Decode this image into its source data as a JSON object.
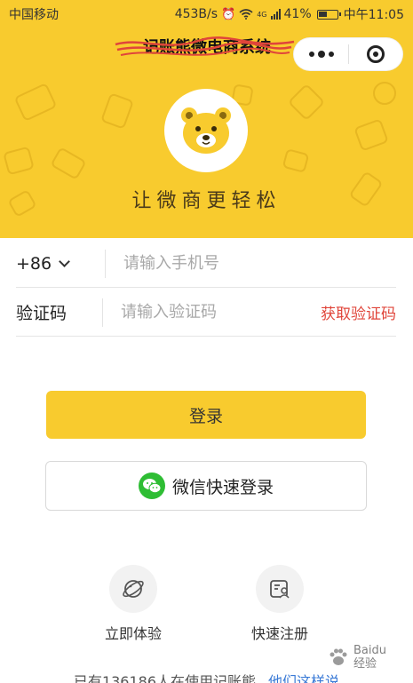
{
  "status_bar": {
    "carrier": "中国移动",
    "speed": "453B/s",
    "network": "4G",
    "battery_percent": "41%",
    "time": "中午11:05"
  },
  "navbar": {
    "title": "记账熊微电商系统",
    "more_icon": "more-dots-icon",
    "close_icon": "target-close-icon"
  },
  "header": {
    "background_color": "#f8cb2e",
    "logo_icon": "bear-face-icon",
    "slogan": "让微商更轻松"
  },
  "form": {
    "country_code": "+86",
    "phone_placeholder": "请输入手机号",
    "code_label": "验证码",
    "code_placeholder": "请输入验证码",
    "get_code_label": "获取验证码",
    "accent_color": "#e0453a"
  },
  "buttons": {
    "login_label": "登录",
    "wechat_login_label": "微信快速登录"
  },
  "actions": [
    {
      "label": "立即体验",
      "icon": "planet-icon"
    },
    {
      "label": "快速注册",
      "icon": "id-card-icon"
    }
  ],
  "footer": {
    "text": "已有136186人在使用记账熊",
    "link": "他们这样说"
  },
  "watermark": {
    "line1": "Baidu",
    "line2": "经验"
  }
}
